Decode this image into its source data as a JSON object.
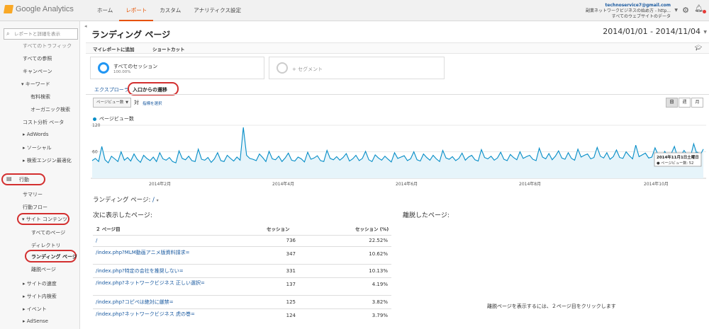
{
  "app": {
    "name": "Google Analytics"
  },
  "topnav": {
    "items": [
      "ホーム",
      "レポート",
      "カスタム",
      "アナリティクス設定"
    ],
    "active_index": 1
  },
  "account": {
    "email": "technoservice7@gmail.com",
    "line1": "副業ネットワークビジネスの始め方 - http...",
    "line2": "すべてのウェブサイトのデータ"
  },
  "sidebar": {
    "search_placeholder": "レポートと詳細を表示",
    "items": [
      "すべてのトラフィック",
      "すべての参照",
      "キャンペーン",
      "▾ キーワード",
      "有料検索",
      "オーガニック検索",
      "コスト分析 ベータ",
      "▸ AdWords",
      "▸ ソーシャル",
      "▸ 検索エンジン最適化",
      "行動",
      "サマリー",
      "行動フロー",
      "▾ サイト コンテンツ",
      "すべてのページ",
      "ディレクトリ",
      "ランディング ページ",
      "離脱ページ",
      "▸ サイトの速度",
      "▸ サイト内検索",
      "▸ イベント",
      "▸ AdSense"
    ]
  },
  "main": {
    "title": "ランディング ページ",
    "date_range": "2014/01/01 - 2014/11/04",
    "toolbar": [
      "マイレポートに追加",
      "ショートカット"
    ],
    "segments": [
      {
        "name": "すべてのセッション",
        "pct": "100.00%"
      },
      {
        "name": "+ セグメント",
        "pct": ""
      }
    ],
    "tabs": [
      "エクスプローラ",
      "入口からの遷移"
    ],
    "active_tab": 1,
    "metric_select": "ページビュー数",
    "vs_label": "対",
    "pick_metric": "指標を選択",
    "granularity": [
      "日",
      "週",
      "月"
    ],
    "active_granularity": 0,
    "landing_label": "ランディング ページ: ",
    "landing_path": "/",
    "next_pages_title": "次に表示したページ:",
    "exit_pages_title": "離脱したページ:",
    "exit_note": "離脱ページを表示するには、２ページ目をクリックします",
    "table": {
      "headers": [
        "２ ページ目",
        "セッション",
        "セッション (%)"
      ],
      "rows": [
        {
          "page": "/",
          "sessions": "736",
          "pct": "22.52%"
        },
        {
          "page": "/index.php?MLM動画アニメ版資料請求=",
          "sessions": "347",
          "pct": "10.62%"
        },
        {
          "page": "/index.php?特定の会社を推奨しない=",
          "sessions": "331",
          "pct": "10.13%"
        },
        {
          "page": "/index.php?ネットワークビジネス 正しい選択=",
          "sessions": "137",
          "pct": "4.19%"
        },
        {
          "page": "/index.php?コピペは絶対に厳禁=",
          "sessions": "125",
          "pct": "3.82%"
        },
        {
          "page": "/index.php?ネットワークビジネス 虎の巻=",
          "sessions": "124",
          "pct": "3.79%"
        }
      ]
    }
  },
  "chart_data": {
    "type": "line",
    "series": [
      {
        "name": "ページビュー数"
      }
    ],
    "y_ticks": [
      "120",
      "60"
    ],
    "x_ticks": [
      "2014年2月",
      "2014年4月",
      "2014年6月",
      "2014年8月",
      "2014年10月"
    ],
    "ylim": [
      0,
      120
    ],
    "values": [
      40,
      45,
      38,
      72,
      42,
      35,
      50,
      44,
      38,
      60,
      41,
      47,
      39,
      55,
      43,
      36,
      52,
      45,
      40,
      48,
      38,
      58,
      44,
      41,
      47,
      38,
      35,
      62,
      45,
      42,
      50,
      40,
      38,
      66,
      43,
      41,
      47,
      36,
      44,
      58,
      40,
      38,
      52,
      45,
      39,
      48,
      41,
      115,
      52,
      45,
      43,
      40,
      55,
      47,
      38,
      61,
      44,
      42,
      50,
      38,
      46,
      57,
      41,
      39,
      48,
      44,
      37,
      59,
      43,
      46,
      51,
      40,
      38,
      63,
      45,
      42,
      49,
      41,
      47,
      56,
      39,
      44,
      52,
      40,
      45,
      61,
      42,
      38,
      53,
      46,
      41,
      50,
      43,
      37,
      58,
      45,
      48,
      51,
      40,
      44,
      60,
      42,
      39,
      55,
      47,
      41,
      52,
      44,
      38,
      63,
      46,
      43,
      49,
      40,
      45,
      57,
      41,
      48,
      52,
      42,
      39,
      65,
      47,
      44,
      50,
      41,
      46,
      59,
      43,
      40,
      54,
      47,
      42,
      60,
      45,
      49,
      52,
      43,
      40,
      68,
      48,
      44,
      56,
      42,
      50,
      62,
      46,
      43,
      58,
      45,
      41,
      66,
      48,
      52,
      55,
      44,
      47,
      70,
      50,
      46,
      58,
      43,
      49,
      64,
      47,
      45,
      60,
      51,
      44,
      75,
      49,
      53,
      57,
      46,
      48,
      69,
      52,
      47,
      61,
      50,
      55,
      72,
      48,
      51,
      63,
      53,
      49,
      78,
      55,
      52,
      66
    ],
    "tooltip": {
      "title": "2014年11月1日土曜日",
      "value_label": "ページビュー数: 52"
    }
  },
  "colors": {
    "line": "#058dc7",
    "area": "#e6f4fa",
    "highlight": "#d32f2f"
  }
}
